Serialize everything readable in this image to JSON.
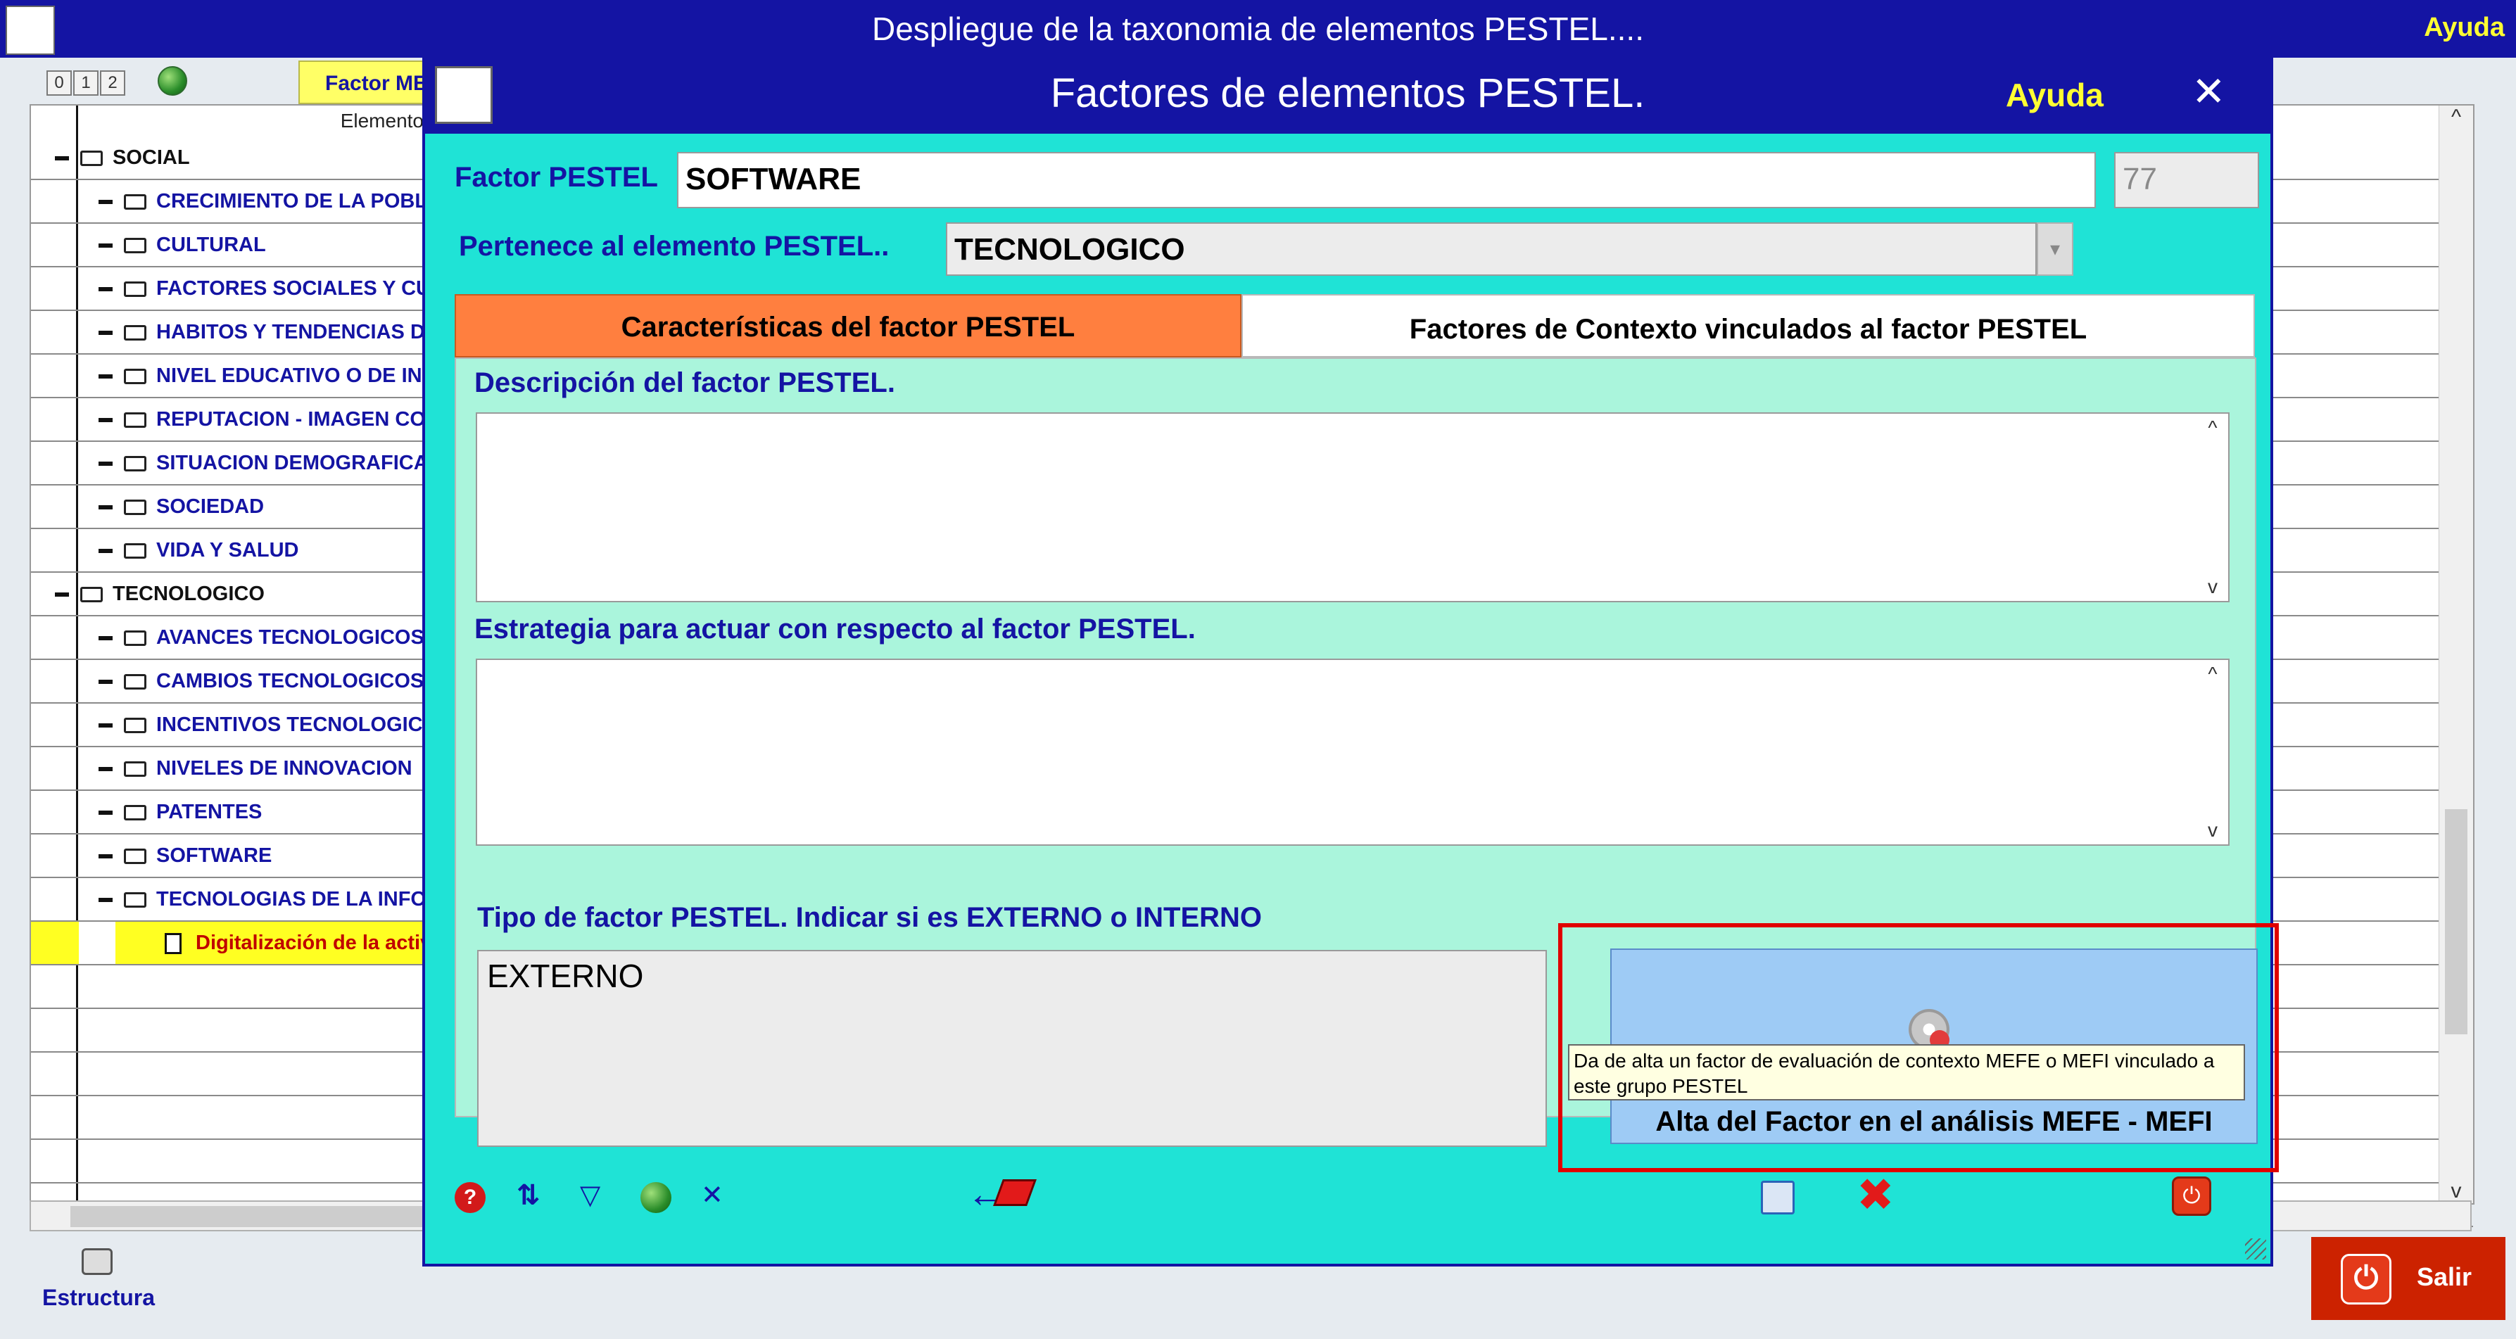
{
  "window": {
    "title": "Despliegue de la taxonomia de elementos PESTEL....",
    "help_label": "Ayuda"
  },
  "toolbar": {
    "levels": [
      "0",
      "1",
      "2"
    ],
    "factor_tab_label": "Factor MEFE"
  },
  "tree": {
    "column_header": "Elementos",
    "rows": [
      {
        "level": 0,
        "label": "SOCIAL"
      },
      {
        "level": 1,
        "label": "CRECIMIENTO DE LA POBLACION"
      },
      {
        "level": 1,
        "label": "CULTURAL"
      },
      {
        "level": 1,
        "label": "FACTORES SOCIALES Y CULTURALES"
      },
      {
        "level": 1,
        "label": "HABITOS Y TENDENCIAS DE CONSUMO"
      },
      {
        "level": 1,
        "label": "NIVEL EDUCATIVO O DE INGRESOS"
      },
      {
        "level": 1,
        "label": "REPUTACION - IMAGEN CORPORATIVA"
      },
      {
        "level": 1,
        "label": "SITUACION DEMOGRAFICA"
      },
      {
        "level": 1,
        "label": "SOCIEDAD"
      },
      {
        "level": 1,
        "label": "VIDA Y SALUD"
      },
      {
        "level": 0,
        "label": "TECNOLOGICO"
      },
      {
        "level": 1,
        "label": "AVANCES TECNOLOGICOS"
      },
      {
        "level": 1,
        "label": "CAMBIOS TECNOLOGICOS"
      },
      {
        "level": 1,
        "label": "INCENTIVOS TECNOLOGICOS"
      },
      {
        "level": 1,
        "label": "NIVELES DE INNOVACION"
      },
      {
        "level": 1,
        "label": "PATENTES"
      },
      {
        "level": 1,
        "label": "SOFTWARE"
      },
      {
        "level": 1,
        "label": "TECNOLOGIAS DE LA INFORMACION"
      },
      {
        "level": 2,
        "label": "Digitalización de la actividad"
      }
    ]
  },
  "footer": {
    "estructura_label": "Estructura",
    "salir_label": "Salir"
  },
  "dialog": {
    "title": "Factores de elementos PESTEL.",
    "help_label": "Ayuda",
    "close_glyph": "✕",
    "factor_label": "Factor PESTEL",
    "factor_value": "SOFTWARE",
    "factor_id": "77",
    "element_label": "Pertenece al elemento PESTEL..",
    "element_value": "TECNOLOGICO",
    "tabs": [
      {
        "label": "Características del factor PESTEL",
        "active": true
      },
      {
        "label": "Factores de Contexto vinculados al factor PESTEL",
        "active": false
      }
    ],
    "descripcion_label": "Descripción del factor PESTEL.",
    "descripcion_value": "",
    "estrategia_label": "Estrategia para actuar con respecto al factor PESTEL.",
    "estrategia_value": "",
    "tipo_label": "Tipo de factor PESTEL. Indicar si es EXTERNO o INTERNO",
    "tipo_value": "EXTERNO",
    "alta_button_label": "Alta del Factor en el análisis MEFE - MEFI",
    "tooltip_text": "Da de alta un factor de evaluación de contexto MEFE o MEFI vinculado a este grupo PESTEL"
  },
  "colors": {
    "titlebar": "#1414a3",
    "help_yellow": "#ffff33",
    "dialog_bg": "#1fe3d6",
    "panel_bg": "#aaf5dc",
    "active_tab": "#ff7f3f",
    "highlight_red": "#e00000",
    "alta_button_bg": "#9ecbf5",
    "selected_row": "#ffff22"
  },
  "icons": [
    "app-logo-icon",
    "globe-icon",
    "folder-icon",
    "document-icon",
    "printer-icon",
    "power-icon",
    "help-icon",
    "sort-az-icon",
    "filter-icon",
    "excel-export-icon",
    "back-book-icon",
    "save-icon",
    "cancel-icon",
    "gear-icon"
  ]
}
